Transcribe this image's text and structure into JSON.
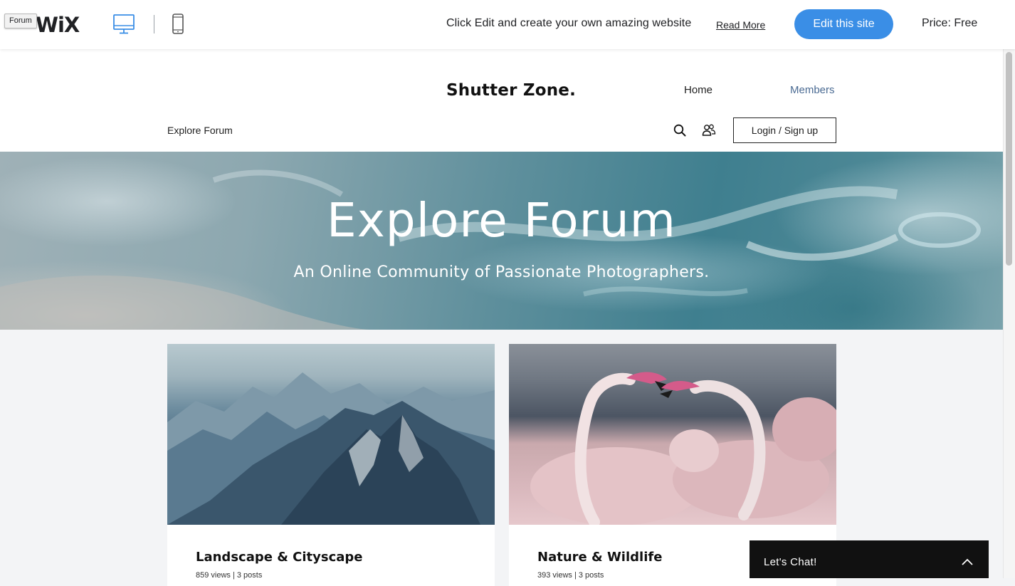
{
  "wix_bar": {
    "logo": "WiX",
    "tooltip": "Forum",
    "promo_text": "Click Edit and create your own amazing website",
    "read_more": "Read More",
    "edit_button": "Edit this site",
    "price": "Price: Free",
    "devices": [
      "desktop-icon",
      "mobile-icon"
    ],
    "active_device": "desktop",
    "accent_color": "#3a8ee6"
  },
  "site": {
    "title": "Shutter Zone.",
    "nav": [
      {
        "label": "Home"
      },
      {
        "label": "Members"
      }
    ],
    "breadcrumb": "Explore Forum",
    "login_button": "Login / Sign up"
  },
  "hero": {
    "title": "Explore Forum",
    "subtitle": "An Online Community of Passionate Photographers."
  },
  "categories": [
    {
      "title": "Landscape & Cityscape",
      "meta": "859 views | 3 posts"
    },
    {
      "title": "Nature & Wildlife",
      "meta": "393 views | 3 posts"
    }
  ],
  "chat": {
    "label": "Let's Chat!"
  }
}
